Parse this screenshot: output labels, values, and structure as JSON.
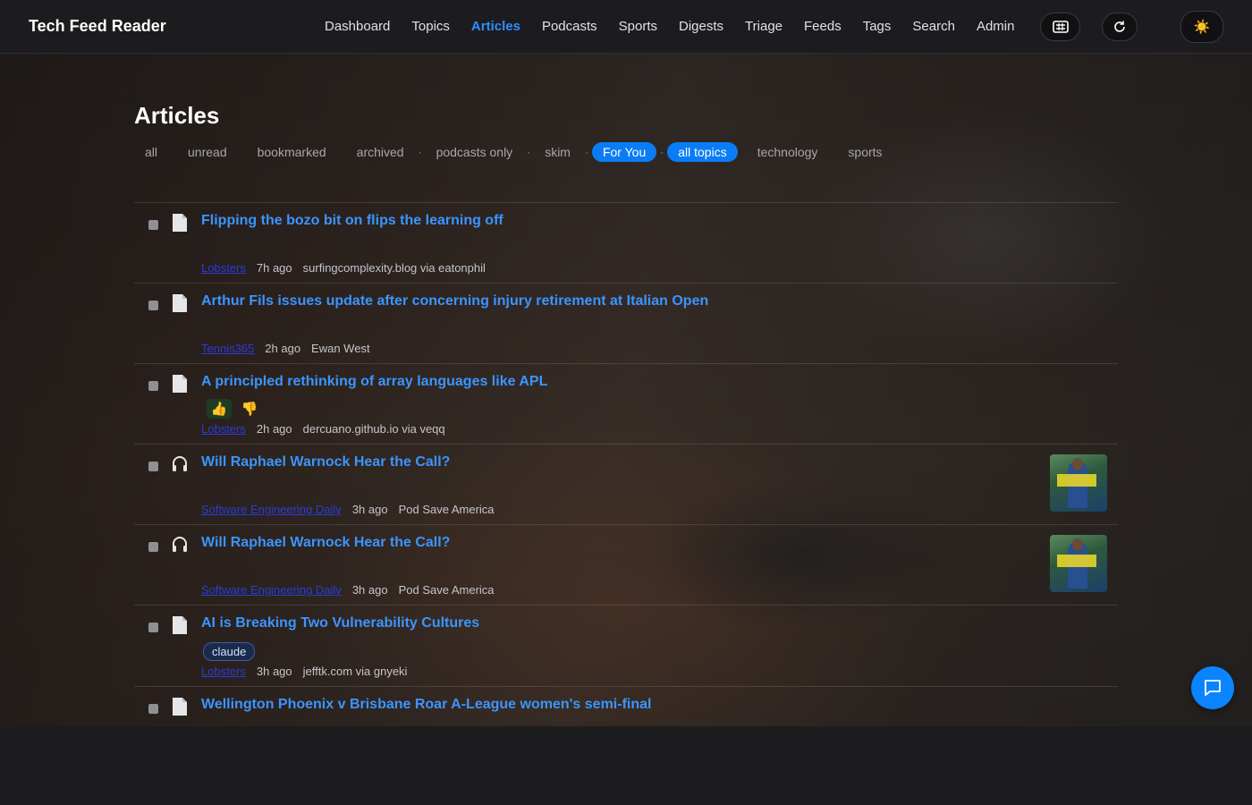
{
  "app": {
    "title": "Tech Feed Reader"
  },
  "nav": {
    "items": [
      {
        "label": "Dashboard"
      },
      {
        "label": "Topics"
      },
      {
        "label": "Articles",
        "active": true
      },
      {
        "label": "Podcasts"
      },
      {
        "label": "Sports"
      },
      {
        "label": "Digests"
      },
      {
        "label": "Triage"
      },
      {
        "label": "Feeds"
      },
      {
        "label": "Tags"
      },
      {
        "label": "Search"
      },
      {
        "label": "Admin"
      }
    ]
  },
  "header_buttons": {
    "keyboard_icon": "keyboard-icon",
    "refresh_icon": "refresh-icon",
    "theme_icon": "sun-icon",
    "theme_glyph": "☀️"
  },
  "page": {
    "title": "Articles"
  },
  "filters": {
    "all": "all",
    "unread": "unread",
    "bookmarked": "bookmarked",
    "archived": "archived",
    "podcasts_only": "podcasts only",
    "skim": "skim",
    "for_you": "For You",
    "all_topics": "all topics",
    "technology": "technology",
    "sports": "sports",
    "separator": "·"
  },
  "articles": [
    {
      "kind": "article",
      "title": "Flipping the bozo bit on flips the learning off",
      "source": "Lobsters",
      "age": "7h ago",
      "origin": "surfingcomplexity.blog via eatonphil"
    },
    {
      "kind": "article",
      "title": "Arthur Fils issues update after concerning injury retirement at Italian Open",
      "source": "Tennis365",
      "age": "2h ago",
      "origin": "Ewan West"
    },
    {
      "kind": "article",
      "title": "A principled rethinking of array languages like APL",
      "source": "Lobsters",
      "age": "2h ago",
      "origin": "dercuano.github.io via veqq",
      "votes": {
        "up": "👍",
        "down": "👎"
      }
    },
    {
      "kind": "podcast",
      "title": "Will Raphael Warnock Hear the Call?",
      "source": "Software Engineering Daily",
      "age": "3h ago",
      "origin": "Pod Save America",
      "thumbnail": "pod-save-america-cover"
    },
    {
      "kind": "podcast",
      "title": "Will Raphael Warnock Hear the Call?",
      "source": "Software Engineering Daily",
      "age": "3h ago",
      "origin": "Pod Save America",
      "thumbnail": "pod-save-america-cover"
    },
    {
      "kind": "article",
      "title": "AI is Breaking Two Vulnerability Cultures",
      "source": "Lobsters",
      "age": "3h ago",
      "origin": "jefftk.com via gnyeki",
      "tag": "claude"
    },
    {
      "kind": "article",
      "title": "Wellington Phoenix v Brisbane Roar A-League women's semi-final"
    }
  ],
  "colors": {
    "accent": "#0a84ff",
    "link": "#3b95ff",
    "background": "#1c1c1e"
  }
}
